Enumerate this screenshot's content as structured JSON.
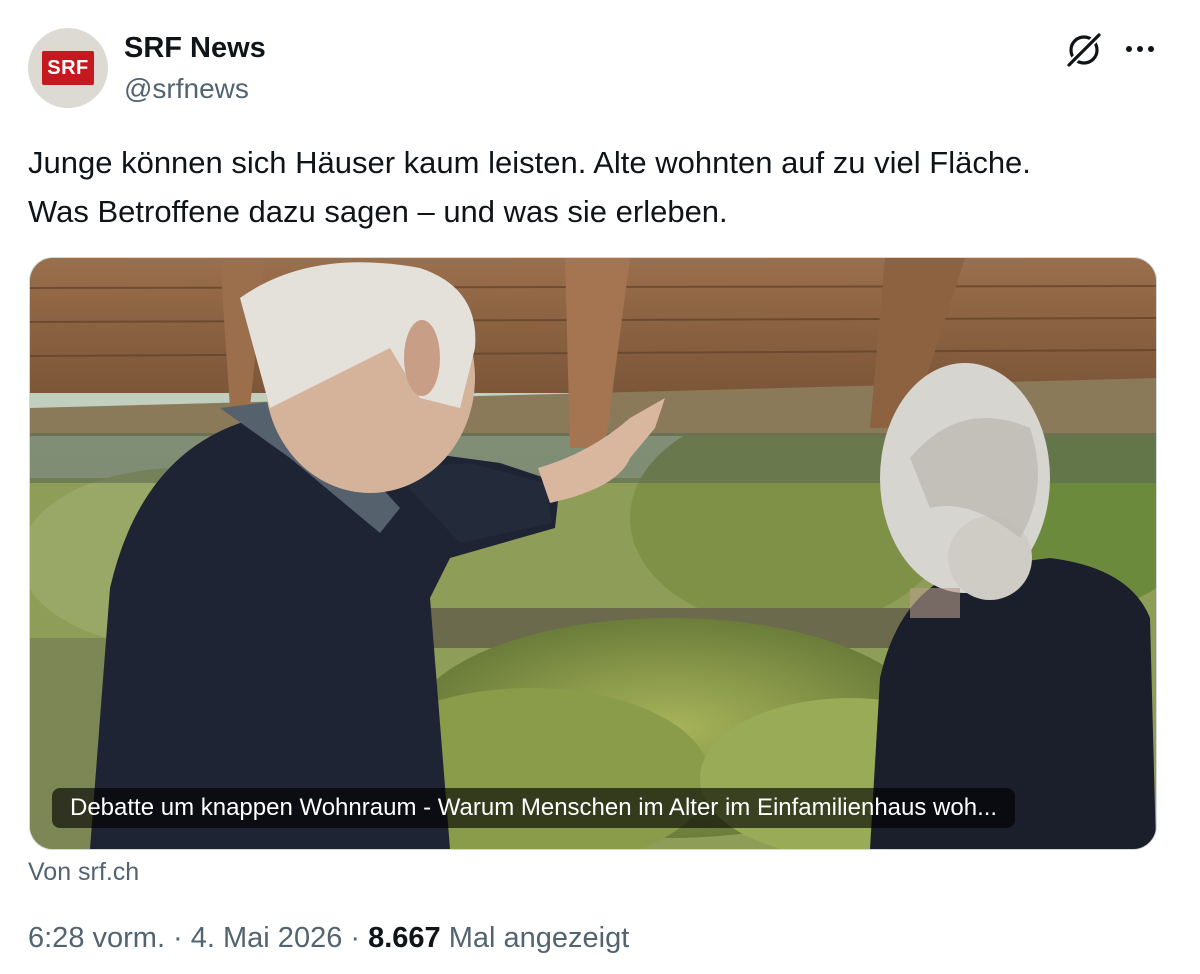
{
  "author": {
    "display_name": "SRF News",
    "handle": "@srfnews",
    "logo_text": "SRF",
    "logo_color": "#c4191f"
  },
  "icons": {
    "grok": "grok-icon",
    "more": "more-dots-icon"
  },
  "tweet": {
    "text_line1": "Junge können sich Häuser kaum leisten. Alte wohnten auf zu viel Fläche.",
    "text_line2": "Was Betroffene dazu sagen – und was sie erleben."
  },
  "card": {
    "caption": "Debatte um knappen Wohnraum - Warum Menschen im Alter im Einfamilienhaus woh...",
    "source": "Von srf.ch"
  },
  "meta": {
    "time": "6:28 vorm.",
    "separator": " · ",
    "date": "4. Mai 2026",
    "views_count": "8.667",
    "views_label": "Mal angezeigt"
  },
  "colors": {
    "text_primary": "#0f1419",
    "text_secondary": "#536471",
    "border": "#cfd9de"
  }
}
